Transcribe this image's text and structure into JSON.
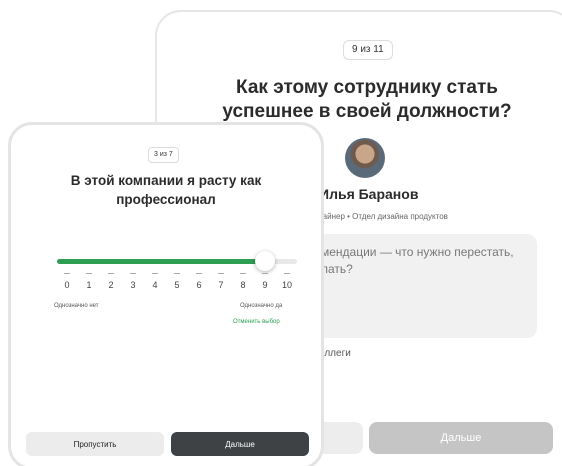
{
  "back_card": {
    "counter": "9 из 11",
    "question": "Как этому сотруднику стать успешнее в своей должности?",
    "person": {
      "name": "Илья Баранов",
      "role": "зайнер • Отдел дизайна продуктов"
    },
    "recommendation_text": "мендации — что нужно перестать, лать?",
    "colleague_note": "оллеги",
    "next_button": "Дальше"
  },
  "front_card": {
    "counter": "3 из 7",
    "question": "В этой компании я расту как профессионал",
    "scale": {
      "ticks": [
        "0",
        "1",
        "2",
        "3",
        "4",
        "5",
        "6",
        "7",
        "8",
        "9",
        "10"
      ],
      "selected_value": 9,
      "min_label": "Однозначно нет",
      "max_label": "Однозначно да"
    },
    "cancel_label": "Отменить выбор",
    "skip_button": "Пропустить",
    "next_button": "Дальше"
  },
  "colors": {
    "accent": "#2e9e52",
    "primary_button": "#3f4245",
    "disabled_button": "#c5c5c5"
  }
}
